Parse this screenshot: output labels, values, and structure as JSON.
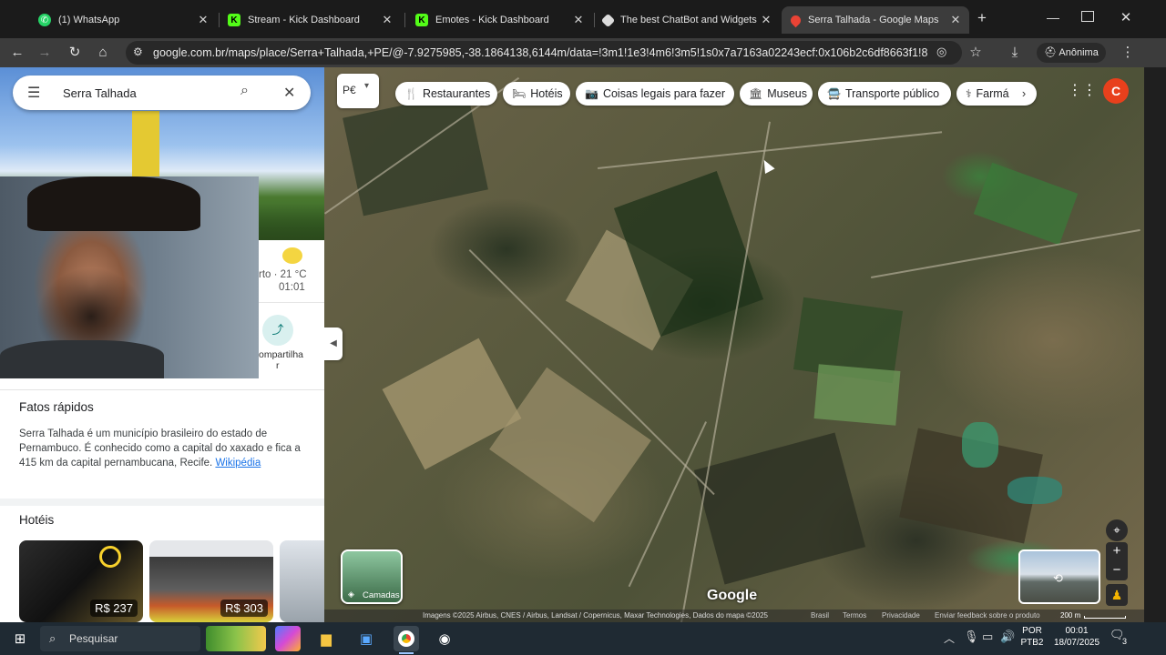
{
  "browser": {
    "tabs": [
      {
        "title": "(1) WhatsApp",
        "close": "✕"
      },
      {
        "title": "Stream - Kick Dashboard",
        "close": "✕"
      },
      {
        "title": "Emotes - Kick Dashboard",
        "close": "✕"
      },
      {
        "title": "The best ChatBot and Widgets",
        "close": "✕"
      },
      {
        "title": "Serra Talhada - Google Maps",
        "close": "✕"
      }
    ],
    "new_tab": "+",
    "url": "google.com.br/maps/place/Serra+Talhada,+PE/@-7.9275985,-38.1864138,6144m/data=!3m1!1e3!4m6!3m5!1s0x7a7163a02243ecf:0x106b2c6df8663f1!8m2!...",
    "profile": "Anônima",
    "avatar_letter": "C"
  },
  "maps": {
    "search_value": "Serra Talhada",
    "chips": [
      "Restaurantes",
      "Hotéis",
      "Coisas legais para fazer",
      "Museus",
      "Transporte público",
      "Farmá"
    ],
    "fatos_title": "Fatos rápidos",
    "fatos_text": "Serra Talhada é um município brasileiro do estado de Pernambuco. É conhecido como a capital do xaxado e fica a 415 km da capital pernambucana, Recife.",
    "fatos_link": "Wikipédia",
    "weather": "rto · 21 °C",
    "weather_time": "01:01",
    "share_label_1": "ompartilha",
    "share_label_2": "r",
    "hoteis_title": "Hotéis",
    "hotel_prices": [
      "R$ 237",
      "R$ 303"
    ],
    "layers_label": "Camadas",
    "lang_btn": "P€",
    "google_logo": "Google",
    "attribution": "Imagens ©2025 Airbus, CNES / Airbus, Landsat / Copernicus, Maxar Technologies, Dados do mapa ©2025",
    "footer_links": [
      "Brasil",
      "Termos",
      "Privacidade",
      "Enviar feedback sobre o produto"
    ],
    "scale": "200 m"
  },
  "taskbar": {
    "search_placeholder": "Pesquisar",
    "lang_top": "POR",
    "lang_bottom": "PTB2",
    "time": "00:01",
    "date": "18/07/2025",
    "notif_count": "3"
  }
}
